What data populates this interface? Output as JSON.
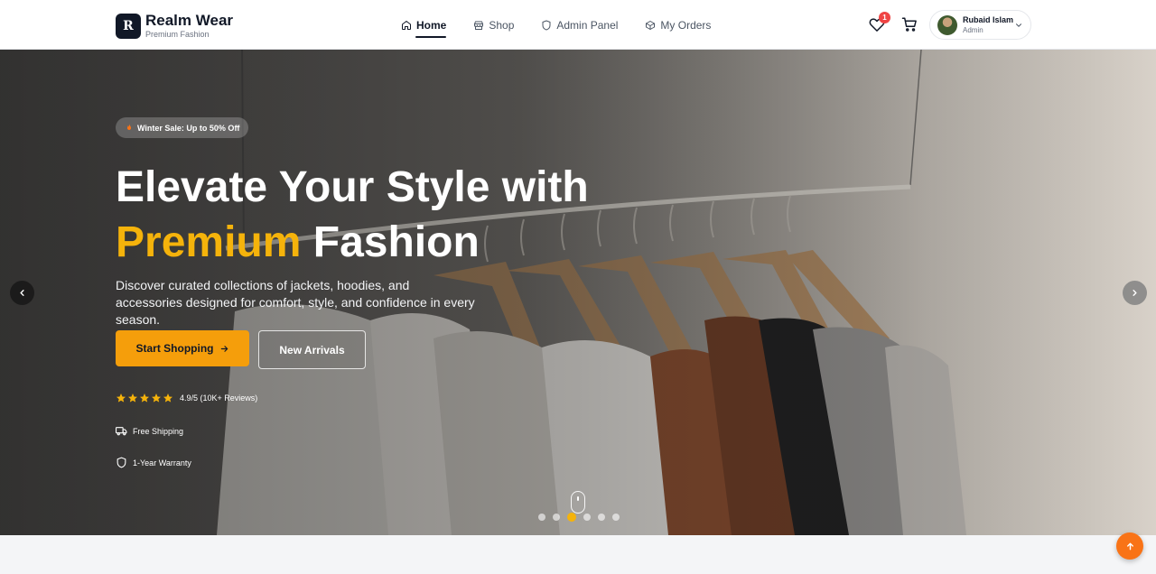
{
  "brand": {
    "initial": "R",
    "name": "Realm Wear",
    "tagline": "Premium Fashion"
  },
  "nav": {
    "items": [
      {
        "label": "Home",
        "icon": "home-icon",
        "active": true
      },
      {
        "label": "Shop",
        "icon": "store-icon"
      },
      {
        "label": "Admin Panel",
        "icon": "shield-icon"
      },
      {
        "label": "My Orders",
        "icon": "package-icon"
      }
    ]
  },
  "header": {
    "wishlist_count": "1"
  },
  "user": {
    "name": "Rubaid Islam",
    "role": "Admin"
  },
  "hero": {
    "sale_badge": "Winter Sale: Up to 50% Off",
    "title_line1": "Elevate Your Style with",
    "title_accent": "Premium",
    "title_rest": "Fashion",
    "subtitle": "Discover curated collections of jackets, hoodies, and accessories designed for comfort, style, and confidence in every season.",
    "primary_button": "Start Shopping",
    "secondary_button": "New Arrivals",
    "rating_text": "4.9/5 (10K+ Reviews)",
    "rating_stars": 5,
    "features": [
      {
        "label": "Free Shipping",
        "icon": "truck-icon"
      },
      {
        "label": "1-Year Warranty",
        "icon": "shield-icon"
      }
    ],
    "slides_total": 6,
    "active_slide": 3
  },
  "colors": {
    "accent": "#f5b30b",
    "primary_button": "#f59e0b",
    "scroll_top": "#f97316",
    "badge": "#ef4444"
  }
}
